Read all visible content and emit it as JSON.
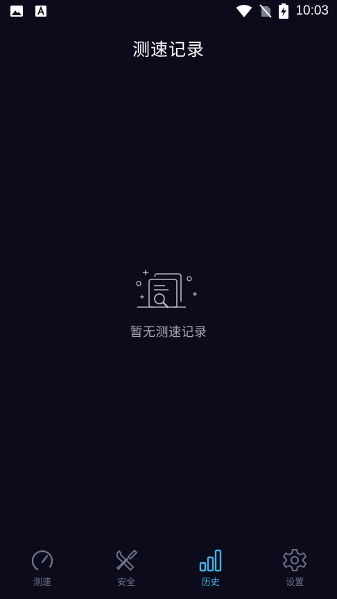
{
  "status_bar": {
    "time": "10:03",
    "left_icons": [
      "image-icon",
      "font-a-icon"
    ],
    "right_icons": [
      "wifi-icon",
      "no-sim-icon",
      "battery-charging-icon"
    ]
  },
  "header": {
    "title": "测速记录"
  },
  "empty_state": {
    "icon": "document-search-icon",
    "message": "暂无测速记录"
  },
  "bottom_nav": {
    "active_index": 2,
    "items": [
      {
        "label": "测速",
        "icon": "speedometer-icon"
      },
      {
        "label": "安全",
        "icon": "tools-icon"
      },
      {
        "label": "历史",
        "icon": "bar-chart-icon"
      },
      {
        "label": "设置",
        "icon": "gear-icon"
      }
    ]
  },
  "colors": {
    "background": "#0b0b1b",
    "accent": "#3fb6e8",
    "inactive": "#6f7286",
    "empty_text": "#a9aab4"
  }
}
